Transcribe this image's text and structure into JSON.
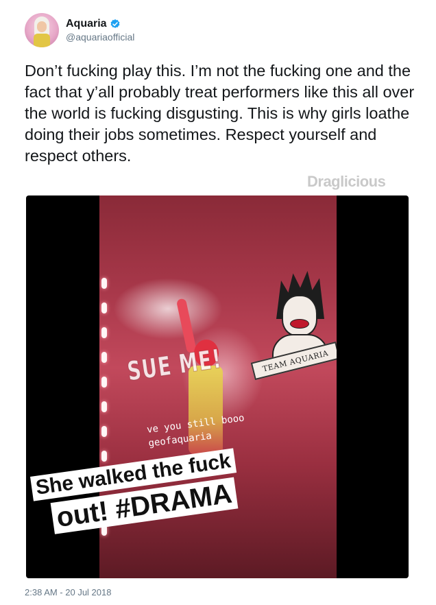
{
  "account": {
    "display_name": "Aquaria",
    "handle": "@aquariaofficial",
    "verified": true,
    "avatar_icon": "avatar-image",
    "verified_icon": "verified-badge-icon",
    "verified_color": "#1da1f2"
  },
  "tweet": {
    "text": "Don’t fucking play this. I’m not the fucking one and the fact that y’all probably treat performers like this all over the world is fucking disgusting. This is why girls loathe doing their jobs sometimes. Respect yourself and respect others.",
    "watermark": "Draglicious",
    "timestamp": "2:38 AM - 20 Jul 2018"
  },
  "media": {
    "sticker_sue_me": "SUE ME!",
    "banner": "TEAM AQUARIA",
    "story_line1": "ve you still booo",
    "story_line2": "geofaquaria",
    "caption_line1": "She walked the fuck",
    "caption_line2": "out! #DRAMA"
  }
}
